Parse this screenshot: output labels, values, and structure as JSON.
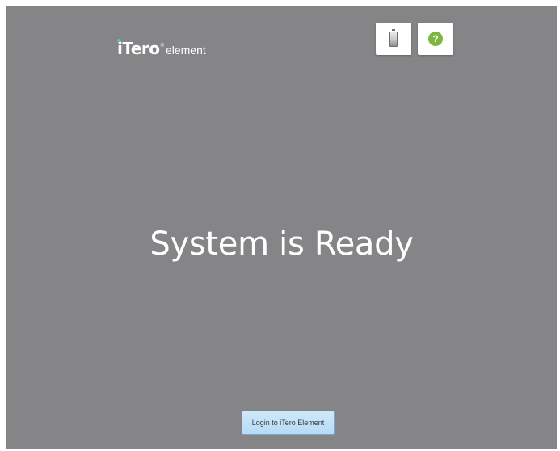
{
  "header": {
    "logo_brand": "iTero",
    "logo_registered": "®",
    "logo_sub": "element",
    "battery_icon": "battery-icon",
    "help_icon": "help-icon",
    "help_symbol": "?"
  },
  "main": {
    "status_text": "System is Ready"
  },
  "footer": {
    "login_label": "Login to iTero Element"
  },
  "colors": {
    "background": "#858587",
    "help_green": "#7cb83f",
    "logo_accent": "#4fc3c7",
    "login_button": "#b6dbf6"
  }
}
